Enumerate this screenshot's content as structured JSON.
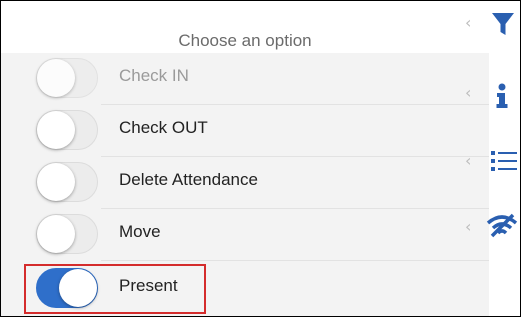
{
  "header": {
    "title": "Choose an option"
  },
  "options": [
    {
      "label": "Check IN",
      "state": "off",
      "disabled": true
    },
    {
      "label": "Check OUT",
      "state": "off",
      "disabled": false
    },
    {
      "label": "Delete Attendance",
      "state": "off",
      "disabled": false
    },
    {
      "label": "Move",
      "state": "off",
      "disabled": false
    },
    {
      "label": "Present",
      "state": "on",
      "disabled": false
    }
  ],
  "side_toolbar": {
    "icons": [
      "filter-icon",
      "info-icon",
      "list-icon",
      "wifi-off-icon"
    ],
    "chevron": "‹"
  },
  "colors": {
    "accent": "#2f6fca",
    "highlight_border": "#d42c2c",
    "panel_bg": "#f3f3f3"
  }
}
